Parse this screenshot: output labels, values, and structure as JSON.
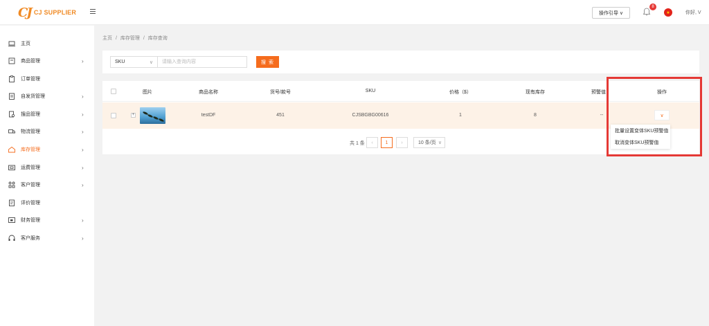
{
  "header": {
    "logo_mark": "CJ",
    "logo_text": "CJ SUPPLIER",
    "guide_label": "操作引导 ∨",
    "notification_count": "8",
    "greeting": "你好, V"
  },
  "sidebar": {
    "items": [
      {
        "label": "主页",
        "icon": "laptop-icon",
        "has_arrow": false
      },
      {
        "label": "商品管理",
        "icon": "package-icon",
        "has_arrow": true
      },
      {
        "label": "订单管理",
        "icon": "clipboard-icon",
        "has_arrow": false
      },
      {
        "label": "自发货管理",
        "icon": "shipping-doc-icon",
        "has_arrow": true
      },
      {
        "label": "搜品管理",
        "icon": "search-doc-icon",
        "has_arrow": true
      },
      {
        "label": "物流管理",
        "icon": "truck-icon",
        "has_arrow": true
      },
      {
        "label": "库存管理",
        "icon": "warehouse-icon",
        "has_arrow": true,
        "active": true
      },
      {
        "label": "运费管理",
        "icon": "freight-icon",
        "has_arrow": true
      },
      {
        "label": "客户管理",
        "icon": "customers-icon",
        "has_arrow": true
      },
      {
        "label": "评价管理",
        "icon": "review-icon",
        "has_arrow": false
      },
      {
        "label": "财务管理",
        "icon": "finance-icon",
        "has_arrow": true
      },
      {
        "label": "客户服务",
        "icon": "headset-icon",
        "has_arrow": true
      }
    ],
    "arrow": "›"
  },
  "breadcrumb": [
    "主页",
    "/",
    "库存管理",
    "/",
    "库存查询"
  ],
  "search": {
    "field_value": "SKU",
    "placeholder": "请输入查询内容",
    "button_label": "搜 索"
  },
  "table": {
    "headers": [
      "图片",
      "商品名称",
      "货号/款号",
      "SKU",
      "价格（$）",
      "现有库存",
      "预警值",
      "操作"
    ],
    "rows": [
      {
        "name": "testDF",
        "item_no": "451",
        "sku": "CJSBGBG00616",
        "price": "1",
        "stock": "8",
        "warning": "--"
      }
    ],
    "expand_symbol": "+",
    "op_symbol": "∨"
  },
  "pagination": {
    "total": "共 1 条",
    "prev": "‹",
    "current": "1",
    "next": "›",
    "page_size": "10 条/页"
  },
  "dropdown": {
    "items": [
      "批量设置变体SKU预警值",
      "取消变体SKU预警值"
    ]
  },
  "colors": {
    "accent": "#f56c1d",
    "highlight": "#e53935",
    "row_bg": "#fdf2e7"
  }
}
